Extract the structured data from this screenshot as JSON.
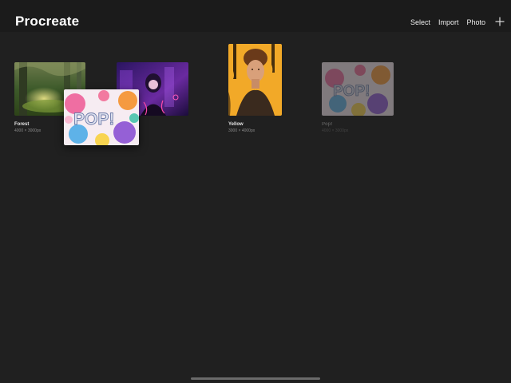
{
  "header": {
    "title": "Procreate",
    "actions": {
      "select": "Select",
      "import": "Import",
      "photo": "Photo"
    }
  },
  "gallery": {
    "items": [
      {
        "name": "Forest",
        "size": "4000 × 3000px"
      },
      {
        "name": "",
        "size": ""
      },
      {
        "name": "Yellow",
        "size": "3000 × 4000px"
      },
      {
        "name": "Pop!",
        "size": "4000 × 3000px"
      }
    ],
    "dragged": {
      "text": "POP!"
    }
  },
  "colors": {
    "background": "#202020",
    "topbar": "#1b1b1b",
    "accent_yellow": "#f2a928"
  }
}
